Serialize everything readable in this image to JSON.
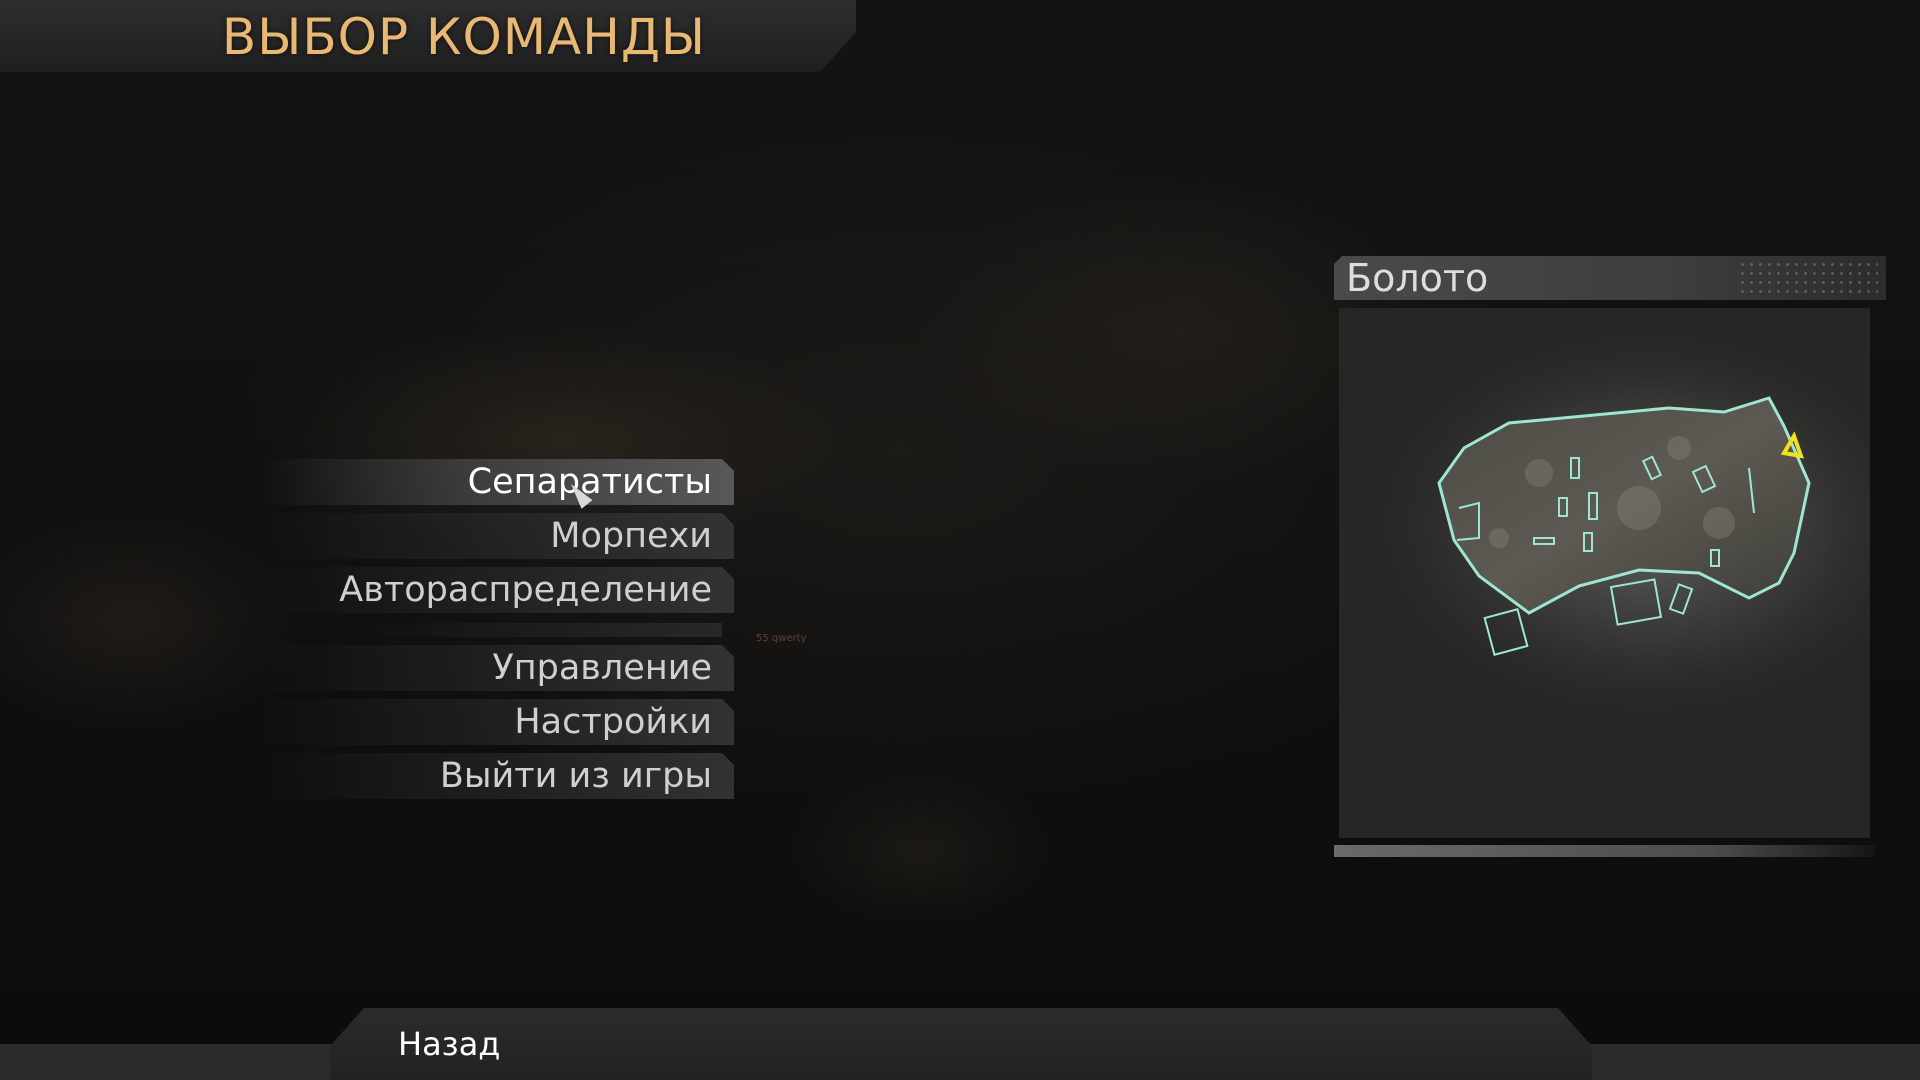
{
  "header": {
    "title": "ВЫБОР КОМАНДЫ"
  },
  "menu": {
    "team_items": [
      {
        "label": "Сепаратисты",
        "selected": true
      },
      {
        "label": "Морпехи",
        "selected": false
      },
      {
        "label": "Автораспределение",
        "selected": false
      }
    ],
    "system_items": [
      {
        "label": "Управление"
      },
      {
        "label": "Настройки"
      },
      {
        "label": "Выйти из игры"
      }
    ]
  },
  "fps_counter": {
    "value": "55",
    "suffix": "qwerty"
  },
  "map_preview": {
    "name": "Болото",
    "player_marker_color": "#f2e21a",
    "outline_color": "#9fe6d2"
  },
  "footer": {
    "back_label": "Назад"
  },
  "colors": {
    "title": "#e9b872",
    "menu_text": "#cfcfcf",
    "menu_active_text": "#ffffff"
  }
}
